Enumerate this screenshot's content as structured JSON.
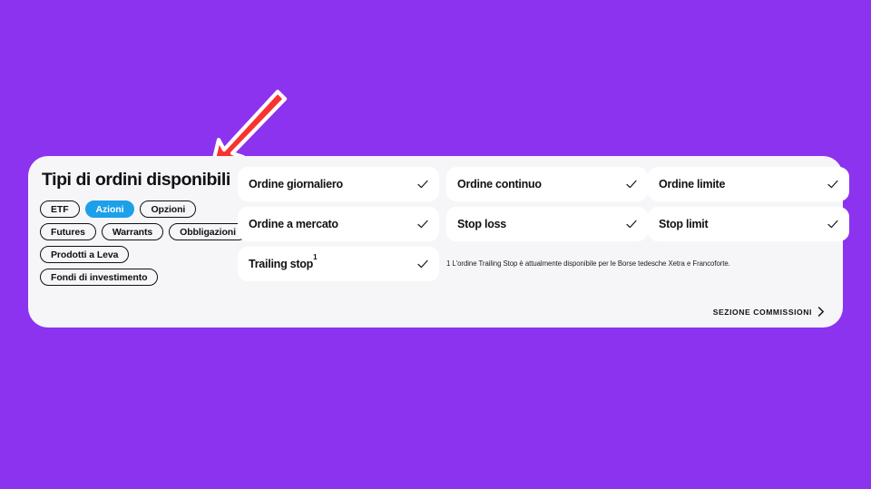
{
  "background_color": "#8c33f0",
  "annotation": {
    "arrow_name": "red-pointer-arrow",
    "arrow_color": "#f73331",
    "arrow_outline_color": "#ffffff"
  },
  "panel": {
    "title": "Tipi di ordini disponibili",
    "background_color": "#f6f6f8",
    "filters": {
      "selected": "Azioni",
      "selected_color": "#1ca0ea",
      "rows": [
        [
          "ETF",
          "Azioni",
          "Opzioni"
        ],
        [
          "Futures",
          "Warrants",
          "Obbligazioni"
        ],
        [
          "Prodotti a Leva"
        ],
        [
          "Fondi di investimento"
        ]
      ]
    },
    "order_columns": [
      [
        {
          "label": "Ordine giornaliero",
          "available": true,
          "footnote_marker": ""
        },
        {
          "label": "Ordine a mercato",
          "available": true,
          "footnote_marker": ""
        },
        {
          "label": "Trailing stop",
          "available": true,
          "footnote_marker": "1"
        }
      ],
      [
        {
          "label": "Ordine continuo",
          "available": true,
          "footnote_marker": ""
        },
        {
          "label": "Stop loss",
          "available": true,
          "footnote_marker": ""
        }
      ],
      [
        {
          "label": "Ordine limite",
          "available": true,
          "footnote_marker": ""
        },
        {
          "label": "Stop limit",
          "available": true,
          "footnote_marker": ""
        }
      ]
    ],
    "footnote": "1 L'ordine Trailing Stop è attualmente disponibile per le Borse tedesche Xetra e Francoforte.",
    "commissions_link": {
      "label": "SEZIONE COMMISSIONI",
      "icon": "chevron-right-icon"
    },
    "check_icon_name": "check-icon"
  }
}
